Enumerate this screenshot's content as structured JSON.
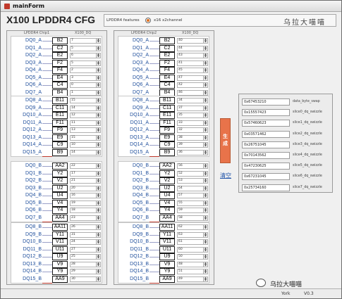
{
  "window": {
    "title": "mainForm"
  },
  "header": {
    "title": "X100 LPDDR4 CFG",
    "features_label": "LPDDR4 features",
    "radio_label": "x16 x2channel",
    "logo_text": "乌拉大喵喵"
  },
  "colors": {
    "accent": "#e8734a",
    "radio": "#e07020"
  },
  "panels": [
    {
      "title": "LPDDR4 Chip1",
      "col": "X100_DQ",
      "groups": [
        {
          "rows": [
            [
              "DQ0_A",
              "B2",
              "7"
            ],
            [
              "DQ1_A",
              "C2",
              "5"
            ],
            [
              "DQ2_A",
              "E2",
              "6"
            ],
            [
              "DQ3_A",
              "F2",
              "5"
            ],
            [
              "DQ4_A",
              "F4",
              "2"
            ],
            [
              "DQ5_A",
              "E4",
              "3"
            ],
            [
              "DQ6_A",
              "C4",
              "0"
            ],
            [
              "DQ7_A",
              "B4",
              "1"
            ]
          ]
        },
        {
          "rows": [
            [
              "DQ8_A",
              "B11",
              "15"
            ],
            [
              "DQ9_A",
              "C11",
              "14"
            ],
            [
              "DQ10_A",
              "E11",
              "12"
            ],
            [
              "DQ11_A",
              "F11",
              "11"
            ],
            [
              "DQ12_A",
              "F9",
              "13"
            ],
            [
              "DQ13_A",
              "E9",
              "15"
            ],
            [
              "DQ14_A",
              "C9",
              "10"
            ],
            [
              "DQ15_A",
              "B9",
              "14"
            ]
          ]
        },
        {
          "rows": [
            [
              "DQ0_B",
              "AA2",
              "22"
            ],
            [
              "DQ1_B",
              "Y2",
              "17"
            ],
            [
              "DQ2_B",
              "V2",
              "21"
            ],
            [
              "DQ3_B",
              "U2",
              "20"
            ],
            [
              "DQ4_B",
              "U4",
              "16"
            ],
            [
              "DQ5_B",
              "V4",
              "19"
            ],
            [
              "DQ6_B",
              "Y4",
              "18"
            ],
            [
              "DQ7_B",
              "AA4",
              "23"
            ]
          ]
        },
        {
          "rows": [
            [
              "DQ8_B",
              "AA11",
              "26"
            ],
            [
              "DQ9_B",
              "Y11",
              "31"
            ],
            [
              "DQ10_B",
              "V11",
              "24"
            ],
            [
              "DQ11_B",
              "U11",
              "27"
            ],
            [
              "DQ12_B",
              "U9",
              "25"
            ],
            [
              "DQ13_B",
              "V9",
              "28"
            ],
            [
              "DQ14_B",
              "Y9",
              "29"
            ],
            [
              "DQ15_B",
              "AA9",
              "30"
            ]
          ]
        }
      ]
    },
    {
      "title": "LPDDR4 Chip2",
      "col": "X100_DQ",
      "groups": [
        {
          "rows": [
            [
              "DQ0_A",
              "B2",
              "40"
            ],
            [
              "DQ1_A",
              "C2",
              "44"
            ],
            [
              "DQ2_A",
              "E2",
              "43"
            ],
            [
              "DQ3_A",
              "F2",
              "41"
            ],
            [
              "DQ4_A",
              "F4",
              "45"
            ],
            [
              "DQ5_A",
              "E4",
              "47"
            ],
            [
              "DQ6_A",
              "C4",
              "42"
            ],
            [
              "DQ7_A",
              "B4",
              "46"
            ]
          ]
        },
        {
          "rows": [
            [
              "DQ8_A",
              "B11",
              "34"
            ],
            [
              "DQ9_A",
              "C11",
              "37"
            ],
            [
              "DQ10_A",
              "E11",
              "35"
            ],
            [
              "DQ11_A",
              "F11",
              "33"
            ],
            [
              "DQ12_A",
              "F9",
              "32"
            ],
            [
              "DQ13_A",
              "E9",
              "38"
            ],
            [
              "DQ14_A",
              "C9",
              "39"
            ],
            [
              "DQ15_A",
              "B9",
              "36"
            ]
          ]
        },
        {
          "rows": [
            [
              "DQ0_B",
              "AA2",
              "56"
            ],
            [
              "DQ1_B",
              "Y2",
              "52"
            ],
            [
              "DQ2_B",
              "V2",
              "53"
            ],
            [
              "DQ3_B",
              "U2",
              "54"
            ],
            [
              "DQ4_B",
              "U4",
              "57"
            ],
            [
              "DQ5_B",
              "V4",
              "55"
            ],
            [
              "DQ6_B",
              "Y4",
              "59"
            ],
            [
              "DQ7_B",
              "AA4",
              "58"
            ]
          ]
        },
        {
          "rows": [
            [
              "DQ8_B",
              "AA11",
              "62"
            ],
            [
              "DQ9_B",
              "Y11",
              "63"
            ],
            [
              "DQ10_B",
              "V11",
              "61"
            ],
            [
              "DQ11_B",
              "U11",
              "60"
            ],
            [
              "DQ12_B",
              "U9",
              "50"
            ],
            [
              "DQ13_B",
              "V9",
              "48"
            ],
            [
              "DQ14_B",
              "Y9",
              "51"
            ],
            [
              "DQ15_B",
              "AA9",
              "49"
            ]
          ]
        }
      ]
    }
  ],
  "actions": {
    "generate": "生成",
    "clear": "清空"
  },
  "results": [
    {
      "value": "0x67453210",
      "label": "data_byte_swap"
    },
    {
      "value": "0x15557423",
      "label": "slice0_dq_swizzle"
    },
    {
      "value": "0x57460623",
      "label": "slice1_dq_swizzle"
    },
    {
      "value": "0x03571462",
      "label": "slice2_dq_swizzle"
    },
    {
      "value": "0x26751045",
      "label": "slice3_dq_swizzle"
    },
    {
      "value": "0x70143562",
      "label": "slice4_dq_swizzle"
    },
    {
      "value": "0x47230625",
      "label": "slice5_dq_swizzle"
    },
    {
      "value": "0x67231045",
      "label": "slice6_dq_swizzle"
    },
    {
      "value": "0x25734160",
      "label": "slice7_dq_swizzle"
    }
  ],
  "status": {
    "user": "York",
    "version": "V0.3"
  },
  "watermark": {
    "text": "乌拉大喵喵"
  }
}
